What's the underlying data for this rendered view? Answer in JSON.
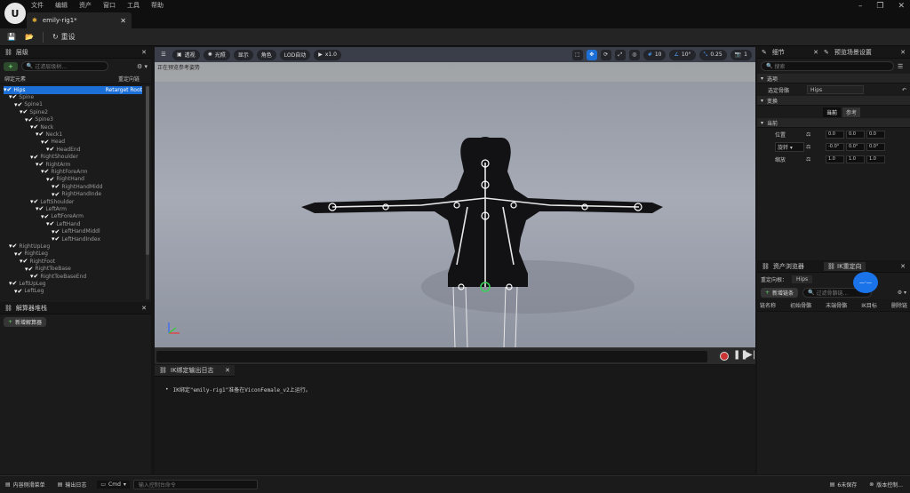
{
  "menu": [
    "文件",
    "编辑",
    "资产",
    "窗口",
    "工具",
    "帮助"
  ],
  "tab": {
    "title": "emily-rig1*"
  },
  "toolbar": {
    "reset_label": "重设"
  },
  "hierarchy": {
    "title": "层级",
    "search_placeholder": "过滤层级树...",
    "col_chain": "绑定元素",
    "col_retarget": "重定向链",
    "root_label": "Retarget Root",
    "items": [
      {
        "label": "Hips",
        "depth": 0
      },
      {
        "label": "Spine",
        "depth": 1
      },
      {
        "label": "Spine1",
        "depth": 2
      },
      {
        "label": "Spine2",
        "depth": 3
      },
      {
        "label": "Spine3",
        "depth": 4
      },
      {
        "label": "Neck",
        "depth": 5
      },
      {
        "label": "Neck1",
        "depth": 6
      },
      {
        "label": "Head",
        "depth": 7
      },
      {
        "label": "HeadEnd",
        "depth": 8
      },
      {
        "label": "RightShoulder",
        "depth": 5
      },
      {
        "label": "RightArm",
        "depth": 6
      },
      {
        "label": "RightForeArm",
        "depth": 7
      },
      {
        "label": "RightHand",
        "depth": 8
      },
      {
        "label": "RightHandMidd",
        "depth": 9
      },
      {
        "label": "RightHandInde",
        "depth": 9
      },
      {
        "label": "LeftShoulder",
        "depth": 5
      },
      {
        "label": "LeftArm",
        "depth": 6
      },
      {
        "label": "LeftForeArm",
        "depth": 7
      },
      {
        "label": "LeftHand",
        "depth": 8
      },
      {
        "label": "LeftHandMiddl",
        "depth": 9
      },
      {
        "label": "LeftHandIndex",
        "depth": 9
      },
      {
        "label": "RightUpLeg",
        "depth": 1
      },
      {
        "label": "RightLeg",
        "depth": 2
      },
      {
        "label": "RightFoot",
        "depth": 3
      },
      {
        "label": "RightToeBase",
        "depth": 4
      },
      {
        "label": "RightToeBaseEnd",
        "depth": 5
      },
      {
        "label": "LeftUpLeg",
        "depth": 1
      },
      {
        "label": "LeftLeg",
        "depth": 2
      }
    ]
  },
  "solver": {
    "title": "解算器堆栈",
    "add_label": "新增解算器"
  },
  "viewport": {
    "buttons": [
      "透视",
      "光照",
      "显示",
      "角色",
      "LOD自动",
      "x1.0"
    ],
    "status": "正在预览参考姿势",
    "grid_value": "10",
    "angle_value": "10°",
    "scale_value": "0.25",
    "camera_value": "1"
  },
  "iklog": {
    "title": "IK绑定输出日志",
    "message": "IK绑定\"emily-rig1\"准备在ViconFemale_v2上运行。"
  },
  "details": {
    "tab1": "细节",
    "tab2": "预览场景设置",
    "search_placeholder": "搜索",
    "section_select": "选项",
    "selected_bone_label": "选定骨骼",
    "selected_bone_value": "Hips",
    "section_transform": "变换",
    "current_label": "当前",
    "reference_label": "参考",
    "section_current": "当前",
    "location_label": "位置",
    "rotation_label": "旋转",
    "scale_label": "缩放",
    "location": [
      "0.0",
      "0.0",
      "0.0"
    ],
    "rotation": [
      "-0.0°",
      "0.0°",
      "0.0°"
    ],
    "scale": [
      "1.0",
      "1.0",
      "1.0"
    ]
  },
  "asset": {
    "tab1": "资产浏览器",
    "tab2": "IK重定向",
    "root_label": "重定向根：",
    "root_value": "Hips",
    "add_chain": "新增链条",
    "search_placeholder": "过滤骨骼链...",
    "columns": [
      "链名称",
      "初始骨骼",
      "末端骨骼",
      "IK目标",
      "删除链"
    ]
  },
  "statusbar": {
    "content_drawer": "内容侧滑菜单",
    "output_log": "输出日志",
    "cmd": "Cmd",
    "cmd_placeholder": "输入控制台命令",
    "unsaved": "6未保存",
    "source_control": "版本控制..."
  }
}
